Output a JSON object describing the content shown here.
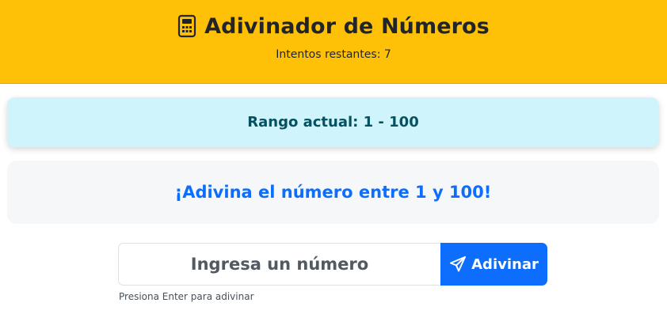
{
  "header": {
    "title": "Adivinador de Números",
    "title_icon": "calculator-icon",
    "attempts_text": "Intentos restantes: 7",
    "background_color": "#ffc107"
  },
  "range_card": {
    "text": "Rango actual: 1 - 100",
    "background_color": "#cff4fc"
  },
  "message_card": {
    "text": "¡Adivina el número entre 1 y 100!",
    "text_color": "#0d6efd"
  },
  "guess_form": {
    "input_value": "",
    "input_placeholder": "Ingresa un número",
    "button_label": "Adivinar",
    "button_icon": "send-icon",
    "button_color": "#0d6efd",
    "hint": "Presiona Enter para adivinar"
  }
}
